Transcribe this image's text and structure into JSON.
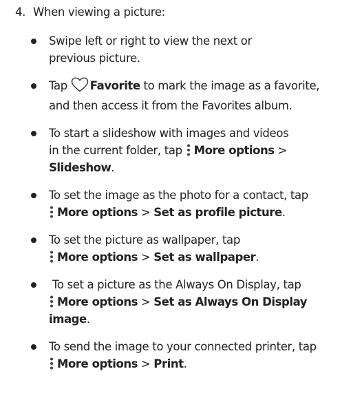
{
  "step": {
    "number": "4.",
    "text": "When viewing a picture:"
  },
  "bullets": [
    {
      "text1": "Swipe left or right to view the next or",
      "text2": "previous picture."
    },
    {
      "pre": "Tap ",
      "icon": "heart-outline-icon",
      "bold": "Favorite",
      "post1": " to mark the image as a favorite,",
      "post2": "and then access it from the Favorites album."
    },
    {
      "line1": "To start a slideshow with images and videos",
      "line2_pre": "in the current folder, tap ",
      "icon": "more-options-icon",
      "bold1": "More options",
      "sep": " > ",
      "bold2": "Slideshow",
      "end": "."
    },
    {
      "line1": "To set the image as the photo for a contact, tap",
      "icon": "more-options-icon",
      "bold1": "More options",
      "sep": " > ",
      "bold2": "Set as profile picture",
      "end": "."
    },
    {
      "line1": "To set the picture as wallpaper, tap",
      "icon": "more-options-icon",
      "bold1": "More options",
      "sep": " > ",
      "bold2": "Set as wallpaper",
      "end": "."
    },
    {
      "line1": " To set a picture as the Always On Display, tap",
      "icon": "more-options-icon",
      "bold1": "More options",
      "sep": " > ",
      "bold2a": "Set as Always On Display",
      "bold2b": "image",
      "end": "."
    },
    {
      "line1": "To send the image to your connected printer, tap",
      "icon": "more-options-icon",
      "bold1": "More options",
      "sep": " > ",
      "bold2": "Print",
      "end": "."
    }
  ]
}
